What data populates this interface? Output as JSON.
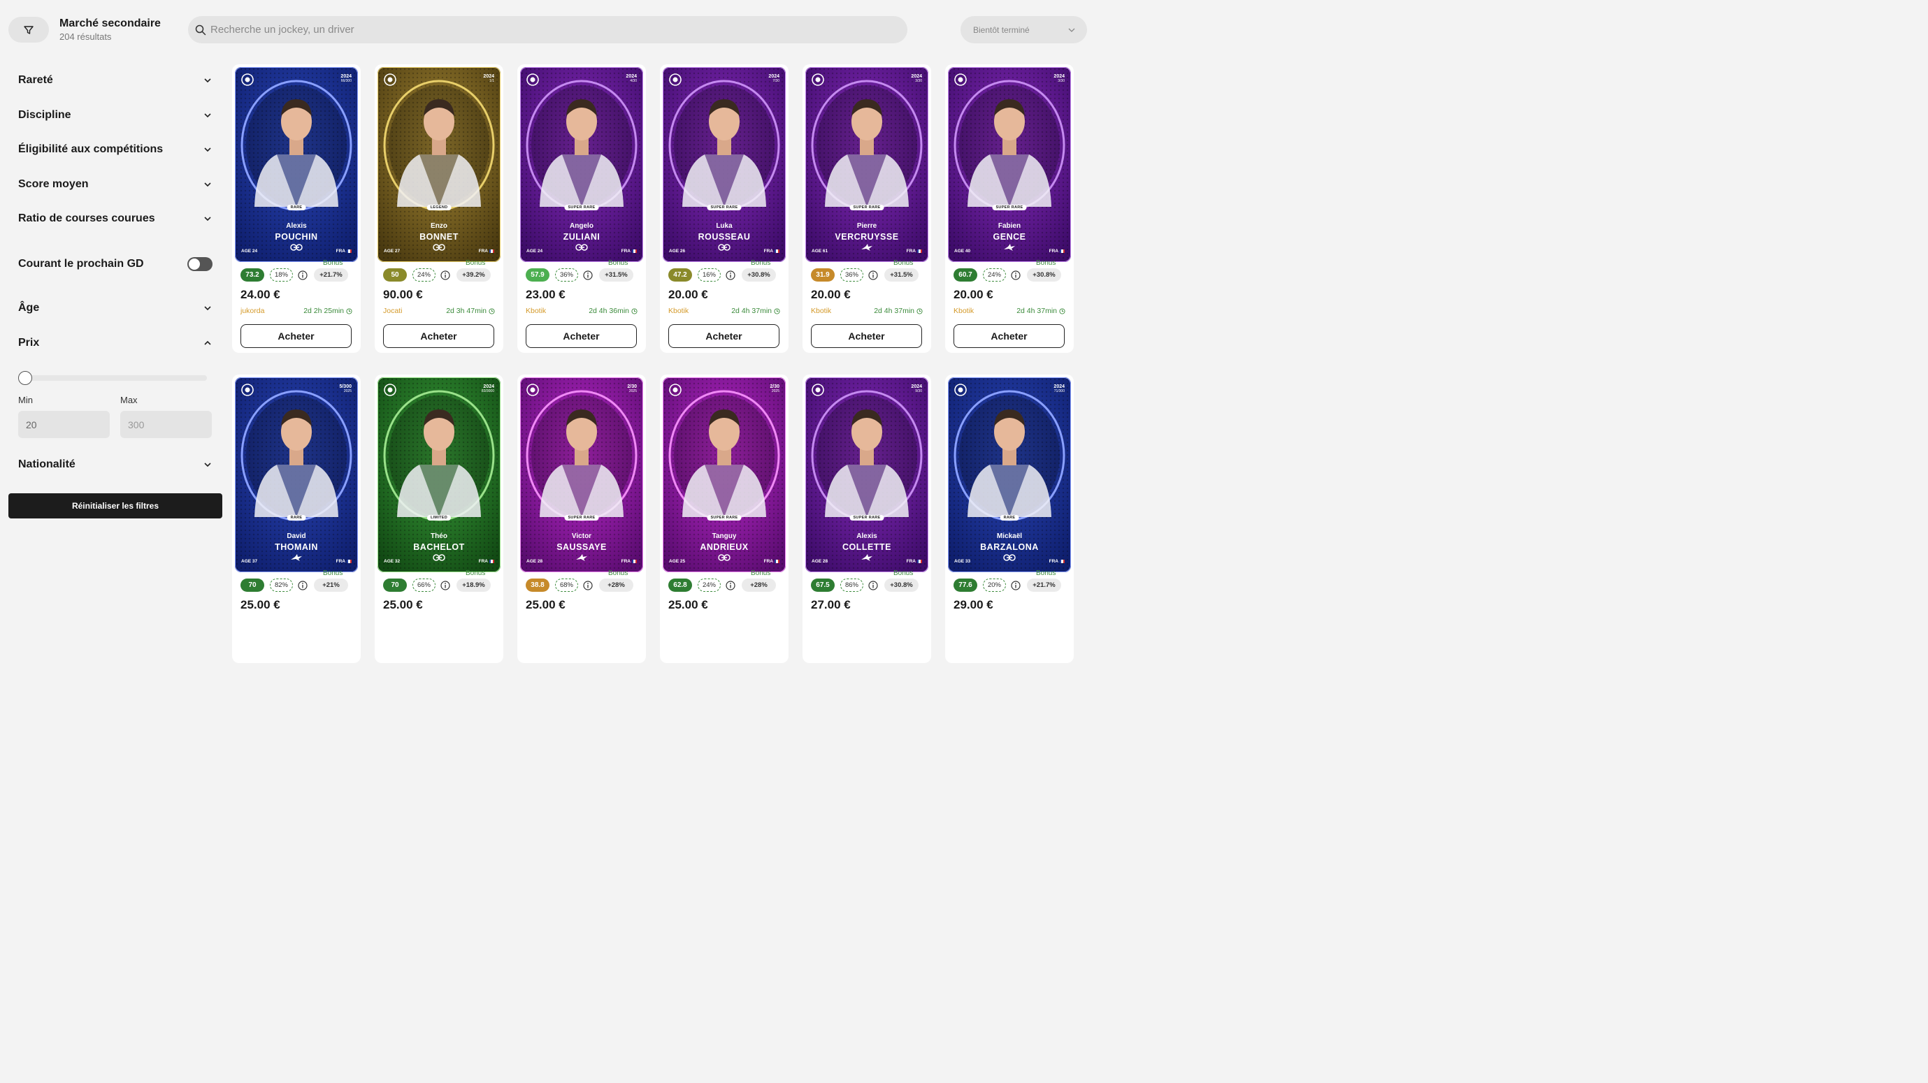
{
  "header": {
    "title": "Marché secondaire",
    "results": "204 résultats",
    "search_placeholder": "Recherche un jockey, un driver",
    "sort_value": "Bientôt terminé"
  },
  "sidebar": {
    "filters": [
      {
        "label": "Rareté"
      },
      {
        "label": "Discipline"
      },
      {
        "label": "Éligibilité aux compétitions"
      },
      {
        "label": "Score moyen"
      },
      {
        "label": "Ratio de courses courues"
      }
    ],
    "toggle_label": "Courant le prochain GD",
    "toggle_on": false,
    "age_label": "Âge",
    "price_label": "Prix",
    "price_min_label": "Min",
    "price_max_label": "Max",
    "price_min_value": "20",
    "price_max_placeholder": "300",
    "nationality_label": "Nationalité",
    "reset_label": "Réinitialiser les filtres"
  },
  "buy_label": "Acheter",
  "bonus_label": "Bonus",
  "cards": [
    {
      "first": "Alexis",
      "last": "POUCHIN",
      "year": "2024",
      "serial": "66/300",
      "rarity": "RARE",
      "age": "AGE 24",
      "nat": "FRA",
      "discipline": "trot",
      "score": "73.2",
      "score_color": "#2e7d32",
      "ratio": "18%",
      "bonus": "+21.7%",
      "price": "24.00 €",
      "seller": "jukorda",
      "time": "2d 2h 25min",
      "theme": "blue"
    },
    {
      "first": "Enzo",
      "last": "BONNET",
      "year": "2024",
      "serial": "1/1",
      "rarity": "LEGEND",
      "age": "AGE 27",
      "nat": "FRA",
      "discipline": "trot",
      "score": "50",
      "score_color": "#8a8a2a",
      "ratio": "24%",
      "bonus": "+39.2%",
      "price": "90.00 €",
      "seller": "Jocati",
      "time": "2d 3h 47min",
      "theme": "gold"
    },
    {
      "first": "Angelo",
      "last": "ZULIANI",
      "year": "2024",
      "serial": "4/30",
      "rarity": "SUPER RARE",
      "age": "AGE 24",
      "nat": "FRA",
      "discipline": "trot",
      "score": "57.9",
      "score_color": "#4caf50",
      "ratio": "36%",
      "bonus": "+31.5%",
      "price": "23.00 €",
      "seller": "Kbotik",
      "time": "2d 4h 36min",
      "theme": "purple"
    },
    {
      "first": "Luka",
      "last": "ROUSSEAU",
      "year": "2024",
      "serial": "7/30",
      "rarity": "SUPER RARE",
      "age": "AGE 26",
      "nat": "FRA",
      "discipline": "trot",
      "score": "47.2",
      "score_color": "#8a8a2a",
      "ratio": "16%",
      "bonus": "+30.8%",
      "price": "20.00 €",
      "seller": "Kbotik",
      "time": "2d 4h 37min",
      "theme": "purple"
    },
    {
      "first": "Pierre",
      "last": "VERCRUYSSE",
      "year": "2024",
      "serial": "3/30",
      "rarity": "SUPER RARE",
      "age": "AGE 61",
      "nat": "FRA",
      "discipline": "gallop",
      "score": "31.9",
      "score_color": "#c68a2a",
      "ratio": "36%",
      "bonus": "+31.5%",
      "price": "20.00 €",
      "seller": "Kbotik",
      "time": "2d 4h 37min",
      "theme": "purple"
    },
    {
      "first": "Fabien",
      "last": "GENCE",
      "year": "2024",
      "serial": "3/30",
      "rarity": "SUPER RARE",
      "age": "AGE 40",
      "nat": "FRA",
      "discipline": "gallop",
      "score": "60.7",
      "score_color": "#2e7d32",
      "ratio": "24%",
      "bonus": "+30.8%",
      "price": "20.00 €",
      "seller": "Kbotik",
      "time": "2d 4h 37min",
      "theme": "purple"
    },
    {
      "first": "David",
      "last": "THOMAIN",
      "year": "5/300",
      "serial": "2025",
      "rarity": "RARE",
      "age": "AGE 37",
      "nat": "FRA",
      "discipline": "gallop",
      "score": "70",
      "score_color": "#2e7d32",
      "ratio": "82%",
      "bonus": "+21%",
      "price": "25.00 €",
      "seller": "",
      "time": "",
      "theme": "blue"
    },
    {
      "first": "Théo",
      "last": "BACHELOT",
      "year": "2024",
      "serial": "83/3000",
      "rarity": "LIMITED",
      "age": "AGE 32",
      "nat": "FRA",
      "discipline": "trot",
      "score": "70",
      "score_color": "#2e7d32",
      "ratio": "66%",
      "bonus": "+18.9%",
      "price": "25.00 €",
      "seller": "",
      "time": "",
      "theme": "green"
    },
    {
      "first": "Victor",
      "last": "SAUSSAYE",
      "year": "2/30",
      "serial": "2025",
      "rarity": "SUPER RARE",
      "age": "AGE 28",
      "nat": "FRA",
      "discipline": "gallop",
      "score": "38.8",
      "score_color": "#c68a2a",
      "ratio": "68%",
      "bonus": "+28%",
      "price": "25.00 €",
      "seller": "",
      "time": "",
      "theme": "magenta"
    },
    {
      "first": "Tanguy",
      "last": "ANDRIEUX",
      "year": "2/30",
      "serial": "2025",
      "rarity": "SUPER RARE",
      "age": "AGE 25",
      "nat": "FRA",
      "discipline": "trot",
      "score": "62.8",
      "score_color": "#2e7d32",
      "ratio": "24%",
      "bonus": "+28%",
      "price": "25.00 €",
      "seller": "",
      "time": "",
      "theme": "magenta"
    },
    {
      "first": "Alexis",
      "last": "COLLETTE",
      "year": "2024",
      "serial": "9/30",
      "rarity": "SUPER RARE",
      "age": "AGE 28",
      "nat": "FRA",
      "discipline": "gallop",
      "score": "67.5",
      "score_color": "#2e7d32",
      "ratio": "86%",
      "bonus": "+30.8%",
      "price": "27.00 €",
      "seller": "",
      "time": "",
      "theme": "purple"
    },
    {
      "first": "Mickaël",
      "last": "BARZALONA",
      "year": "2024",
      "serial": "71/300",
      "rarity": "RARE",
      "age": "AGE 33",
      "nat": "FRA",
      "discipline": "trot",
      "score": "77.6",
      "score_color": "#2e7d32",
      "ratio": "20%",
      "bonus": "+21.7%",
      "price": "29.00 €",
      "seller": "",
      "time": "",
      "theme": "blue"
    }
  ],
  "themes": {
    "blue": {
      "bg1": "#2a46b8",
      "bg2": "#0f1f6e",
      "ring": "#8aa0ff"
    },
    "gold": {
      "bg1": "#a88a35",
      "bg2": "#4a3a10",
      "ring": "#e8cf6a"
    },
    "purple": {
      "bg1": "#8a2cc0",
      "bg2": "#3e0c6a",
      "ring": "#c58af0"
    },
    "green": {
      "bg1": "#3aa03a",
      "bg2": "#124a14",
      "ring": "#9ae28a"
    },
    "magenta": {
      "bg1": "#c02ad0",
      "bg2": "#5a0c70",
      "ring": "#f08af5"
    }
  }
}
